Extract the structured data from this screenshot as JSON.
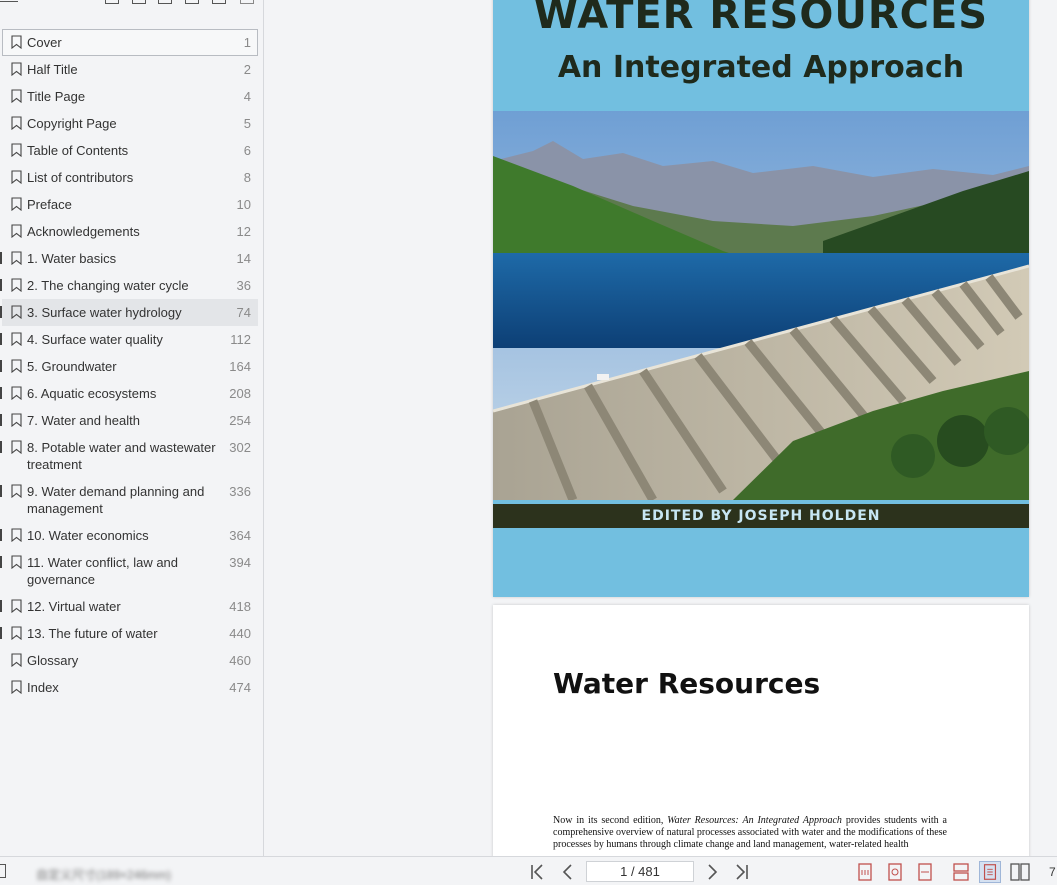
{
  "bookmarks": {
    "items": [
      {
        "label": "Cover",
        "page": "1"
      },
      {
        "label": "Half Title",
        "page": "2"
      },
      {
        "label": "Title Page",
        "page": "4"
      },
      {
        "label": "Copyright Page",
        "page": "5"
      },
      {
        "label": "Table of Contents",
        "page": "6"
      },
      {
        "label": "List of contributors",
        "page": "8"
      },
      {
        "label": "Preface",
        "page": "10"
      },
      {
        "label": "Acknowledgements",
        "page": "12"
      },
      {
        "label": "1. Water basics",
        "page": "14"
      },
      {
        "label": "2. The changing water cycle",
        "page": "36"
      },
      {
        "label": "3. Surface water hydrology",
        "page": "74"
      },
      {
        "label": "4. Surface water quality",
        "page": "112"
      },
      {
        "label": "5. Groundwater",
        "page": "164"
      },
      {
        "label": "6. Aquatic ecosystems",
        "page": "208"
      },
      {
        "label": "7. Water and health",
        "page": "254"
      },
      {
        "label": "8. Potable water and wastewater treatment",
        "page": "302"
      },
      {
        "label": "9. Water demand planning and management",
        "page": "336"
      },
      {
        "label": "10. Water economics",
        "page": "364"
      },
      {
        "label": "11. Water conflict, law and governance",
        "page": "394"
      },
      {
        "label": "12. Virtual water",
        "page": "418"
      },
      {
        "label": "13. The future of water",
        "page": "440"
      },
      {
        "label": "Glossary",
        "page": "460"
      },
      {
        "label": "Index",
        "page": "474"
      }
    ]
  },
  "cover": {
    "title": "WATER RESOURCES",
    "subtitle": "An Integrated Approach",
    "editor": "EDITED BY JOSEPH HOLDEN"
  },
  "page2": {
    "title": "Water Resources",
    "text_pre": "Now in its second edition, ",
    "text_italic": "Water Resources: An Integrated Approach",
    "text_post": " provides students with a comprehensive overview of natural processes associated with water and the modifications of these processes by humans through climate change and land management, water-related health"
  },
  "statusbar": {
    "left_text": "自定义尺寸(189×246mm)",
    "page_indicator": "1 / 481",
    "zoom": "7"
  },
  "colors": {
    "cover_blue": "#72bfe0",
    "band": "#2c321c",
    "selected_row": "#e3e5e8"
  }
}
